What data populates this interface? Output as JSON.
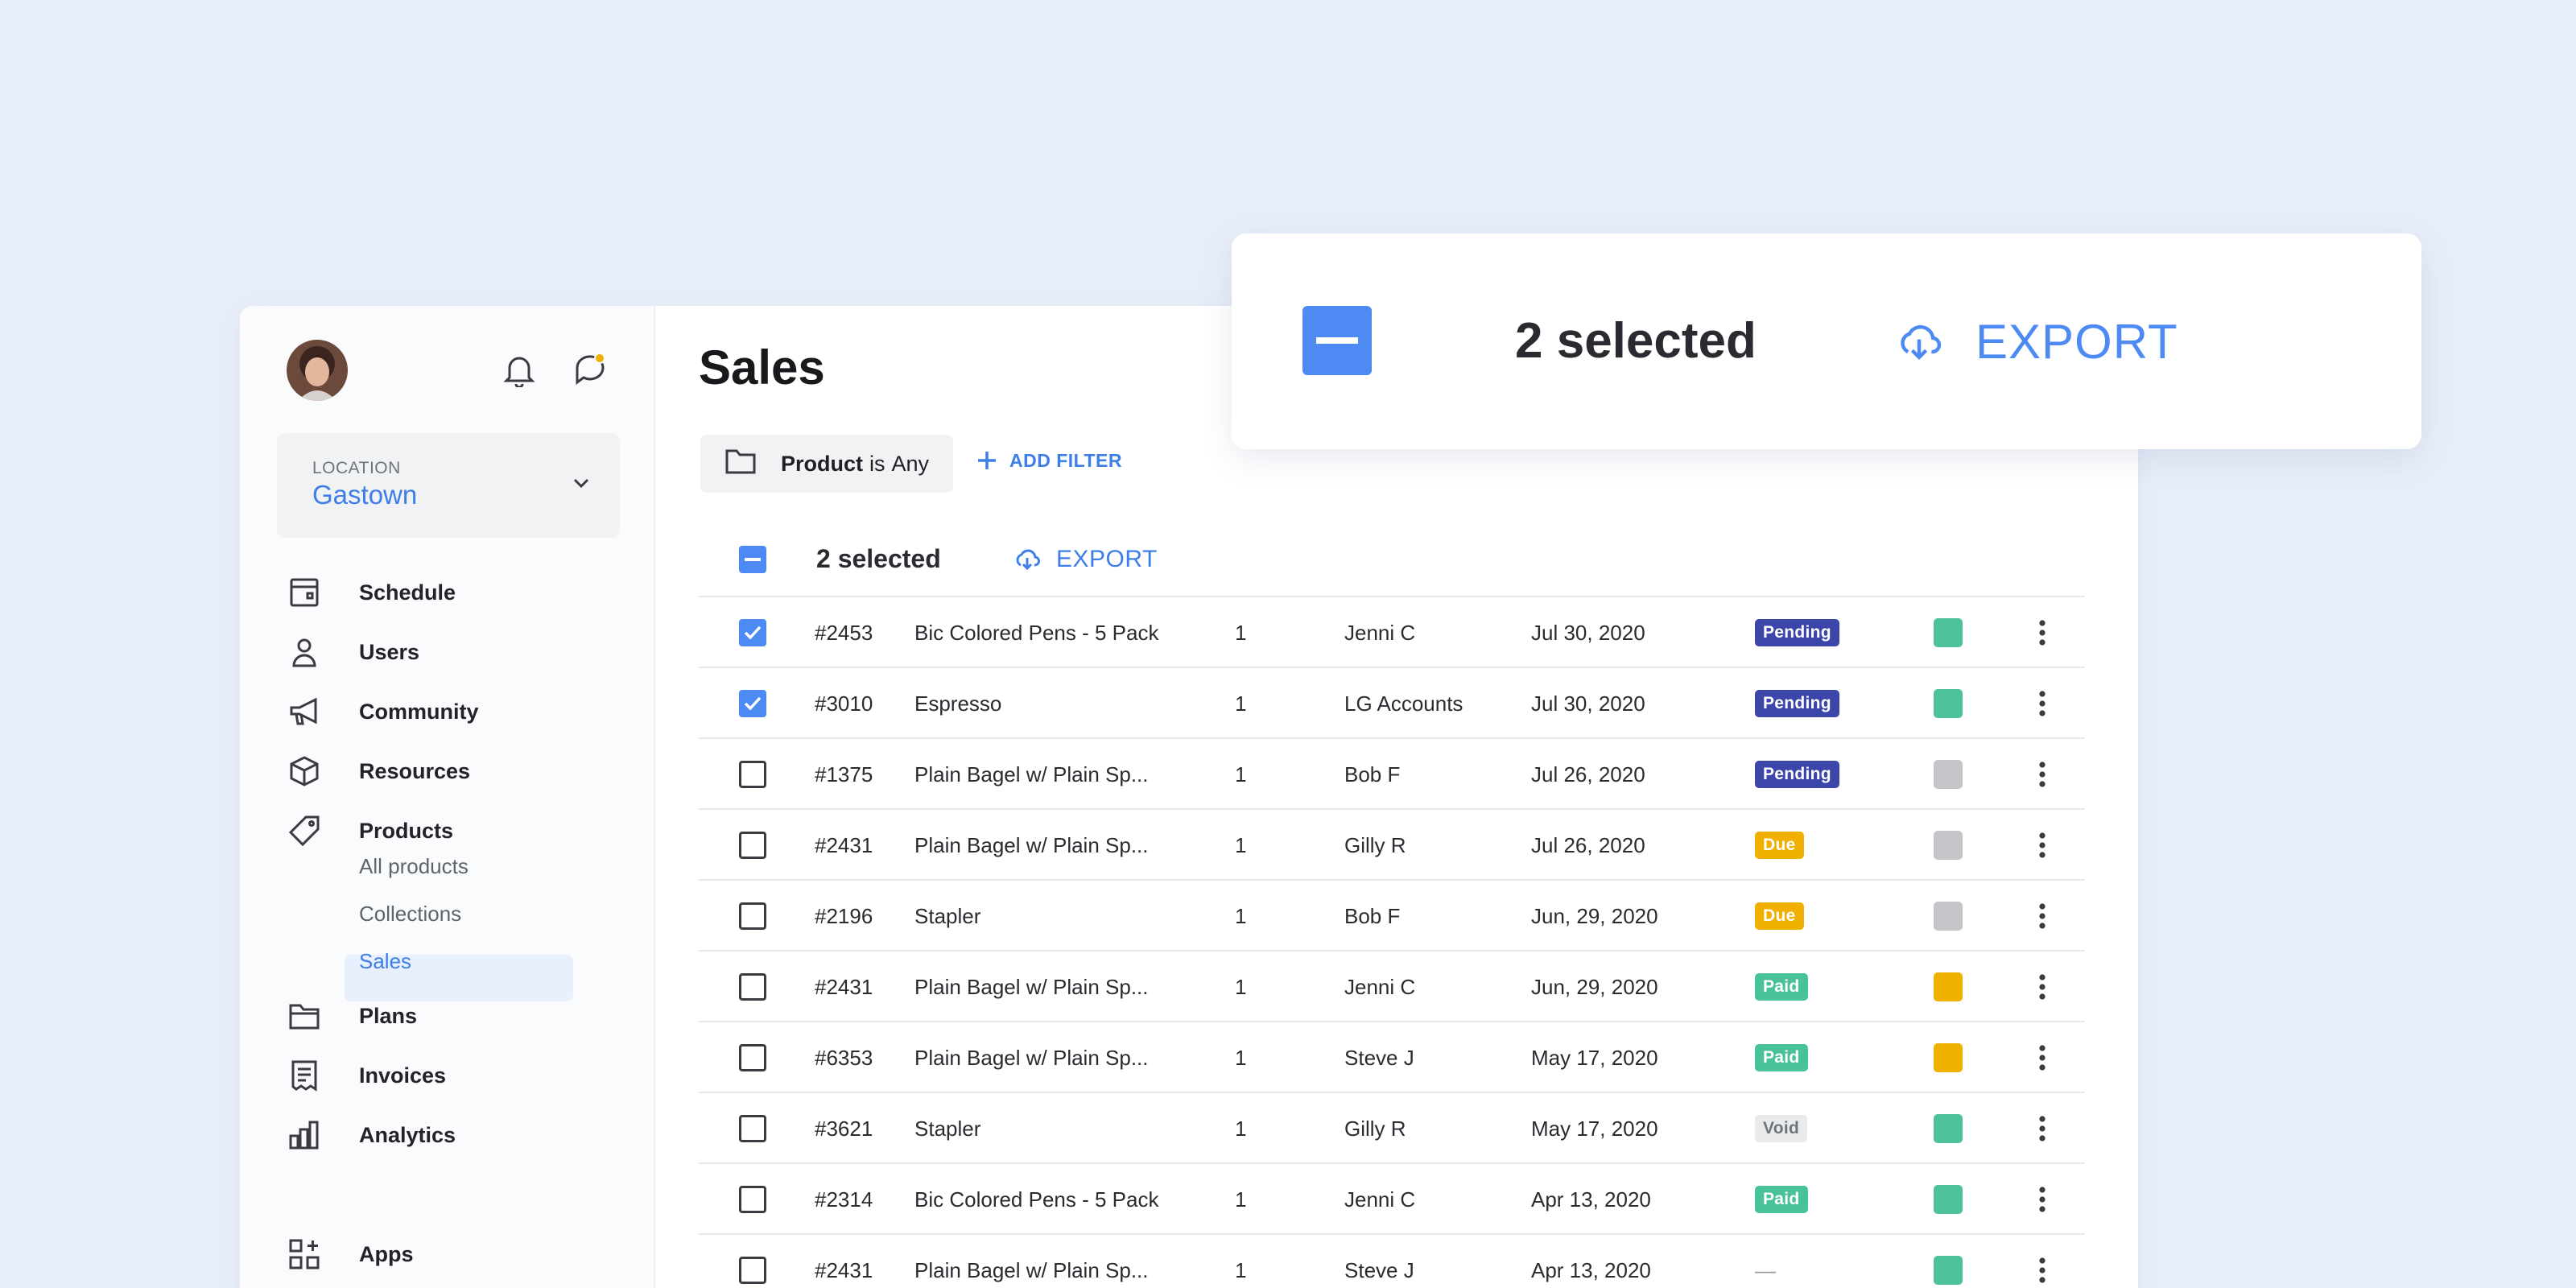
{
  "sidebar": {
    "location_label": "LOCATION",
    "location_value": "Gastown",
    "nav": [
      {
        "label": "Schedule",
        "icon": "calendar-icon"
      },
      {
        "label": "Users",
        "icon": "user-icon"
      },
      {
        "label": "Community",
        "icon": "megaphone-icon"
      },
      {
        "label": "Resources",
        "icon": "cube-icon"
      },
      {
        "label": "Products",
        "icon": "tag-icon"
      },
      {
        "label": "Plans",
        "icon": "folder-icon"
      },
      {
        "label": "Invoices",
        "icon": "receipt-icon"
      },
      {
        "label": "Analytics",
        "icon": "bar-chart-icon"
      },
      {
        "label": "Apps",
        "icon": "apps-grid-icon"
      }
    ],
    "sub_items": [
      "All products",
      "Collections",
      "Sales"
    ],
    "active_sub": "Sales"
  },
  "main": {
    "title": "Sales",
    "filter": {
      "field": "Product",
      "op": "is",
      "value": "Any"
    },
    "add_filter_label": "ADD FILTER",
    "selection": {
      "count_label": "2 selected",
      "export_label": "EXPORT"
    }
  },
  "callout": {
    "count_label": "2 selected",
    "export_label": "EXPORT"
  },
  "colors": {
    "accent": "#3d7ee8",
    "pending": "#3c46a8",
    "due": "#f0b000",
    "paid": "#48c29a",
    "void_bg": "#e9eaec",
    "swatch_green": "#4ec39a",
    "swatch_gray": "#c4c5c8",
    "swatch_yellow": "#f0b000"
  },
  "rows": [
    {
      "checked": true,
      "id": "#2453",
      "product": "Bic Colored Pens - 5 Pack",
      "qty": "1",
      "customer": "Jenni C",
      "date": "Jul 30, 2020",
      "status": "Pending",
      "swatch": "green"
    },
    {
      "checked": true,
      "id": "#3010",
      "product": "Espresso",
      "qty": "1",
      "customer": "LG Accounts",
      "date": "Jul 30, 2020",
      "status": "Pending",
      "swatch": "green"
    },
    {
      "checked": false,
      "id": "#1375",
      "product": "Plain Bagel w/ Plain Sp...",
      "qty": "1",
      "customer": "Bob F",
      "date": "Jul 26, 2020",
      "status": "Pending",
      "swatch": "gray"
    },
    {
      "checked": false,
      "id": "#2431",
      "product": "Plain Bagel w/ Plain Sp...",
      "qty": "1",
      "customer": "Gilly R",
      "date": "Jul 26, 2020",
      "status": "Due",
      "swatch": "gray"
    },
    {
      "checked": false,
      "id": "#2196",
      "product": "Stapler",
      "qty": "1",
      "customer": "Bob F",
      "date": "Jun, 29, 2020",
      "status": "Due",
      "swatch": "gray"
    },
    {
      "checked": false,
      "id": "#2431",
      "product": "Plain Bagel w/ Plain Sp...",
      "qty": "1",
      "customer": "Jenni C",
      "date": "Jun, 29, 2020",
      "status": "Paid",
      "swatch": "yellow"
    },
    {
      "checked": false,
      "id": "#6353",
      "product": "Plain Bagel w/ Plain Sp...",
      "qty": "1",
      "customer": "Steve J",
      "date": "May 17, 2020",
      "status": "Paid",
      "swatch": "yellow"
    },
    {
      "checked": false,
      "id": "#3621",
      "product": "Stapler",
      "qty": "1",
      "customer": "Gilly R",
      "date": "May 17, 2020",
      "status": "Void",
      "swatch": "green"
    },
    {
      "checked": false,
      "id": "#2314",
      "product": "Bic Colored Pens - 5 Pack",
      "qty": "1",
      "customer": "Jenni C",
      "date": "Apr 13, 2020",
      "status": "Paid",
      "swatch": "green"
    },
    {
      "checked": false,
      "id": "#2431",
      "product": "Plain Bagel w/ Plain Sp...",
      "qty": "1",
      "customer": "Steve J",
      "date": "Apr 13, 2020",
      "status": "—",
      "swatch": "green"
    }
  ]
}
